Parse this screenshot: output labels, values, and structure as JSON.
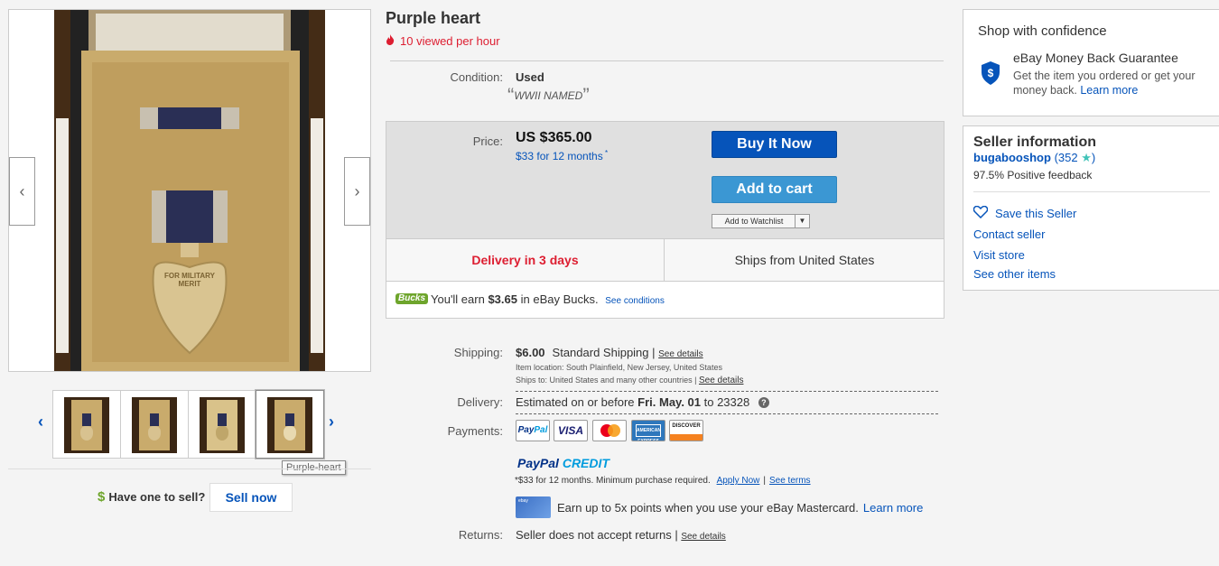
{
  "gallery": {
    "prev_arrow": "‹",
    "next_arrow": "›",
    "thumb_prev": "‹",
    "thumb_next": "›",
    "tooltip": "Purple-heart",
    "medal_text": "FOR MILITARY MERIT"
  },
  "sell": {
    "dollar": "$",
    "question": "Have one to sell?",
    "button": "Sell now"
  },
  "listing": {
    "title": "Purple heart",
    "views": "10 viewed per hour",
    "condition_label": "Condition:",
    "condition_value": "Used",
    "condition_note": "WWII NAMED",
    "price_label": "Price:",
    "price": "US $365.00",
    "monthly": "$33 for 12 months",
    "buy_now": "Buy It Now",
    "add_to_cart": "Add to cart",
    "watchlist": "Add to Watchlist",
    "delivery_fast": "Delivery in 3 days",
    "ships_from": "Ships from United States",
    "bucks_logo": "Bucks",
    "bucks_prefix": "You'll earn",
    "bucks_amount": "$3.65",
    "bucks_suffix": "in eBay Bucks.",
    "bucks_conditions": "See conditions"
  },
  "details": {
    "shipping_label": "Shipping:",
    "shipping_cost": "$6.00",
    "shipping_method": "Standard Shipping |",
    "see_details": "See details",
    "item_location": "Item location:  South Plainfield, New Jersey, United States",
    "ships_to": "Ships to:  United States and many other countries |",
    "delivery_label": "Delivery:",
    "delivery_prefix": "Estimated on or before",
    "delivery_date": "Fri. May. 01",
    "delivery_suffix": "to 23328",
    "payments_label": "Payments:",
    "paypal_credit_a": "PayPal",
    "paypal_credit_b": "CREDIT",
    "ppc_note": "*$33 for 12 months. Minimum purchase required.",
    "apply_now": "Apply Now",
    "see_terms": "See terms",
    "mc_text": "Earn up to 5x points when you use your eBay Mastercard.",
    "learn_more": "Learn more",
    "returns_label": "Returns:",
    "returns_value": "Seller does not accept returns |"
  },
  "cards": {
    "paypal_a": "Pay",
    "paypal_b": "Pal",
    "visa": "VISA",
    "amex": "AMERICAN EXPRESS",
    "discover": "DISCOVER",
    "ebay_card": "ebay"
  },
  "confidence": {
    "title": "Shop with confidence",
    "mbg_title": "eBay Money Back Guarantee",
    "mbg_desc": "Get the item you ordered or get your money back.",
    "learn_more": "Learn more"
  },
  "seller": {
    "title": "Seller information",
    "name": "bugabooshop",
    "score_open": "(352",
    "score_close": ")",
    "feedback": "97.5% Positive feedback",
    "save": "Save this Seller",
    "contact": "Contact seller",
    "visit": "Visit store",
    "other": "See other items"
  },
  "colors": {
    "accent_blue": "#0654ba",
    "alert_red": "#dd1e31",
    "bucks_green": "#6ea52c",
    "star_teal": "#41c3b8"
  }
}
